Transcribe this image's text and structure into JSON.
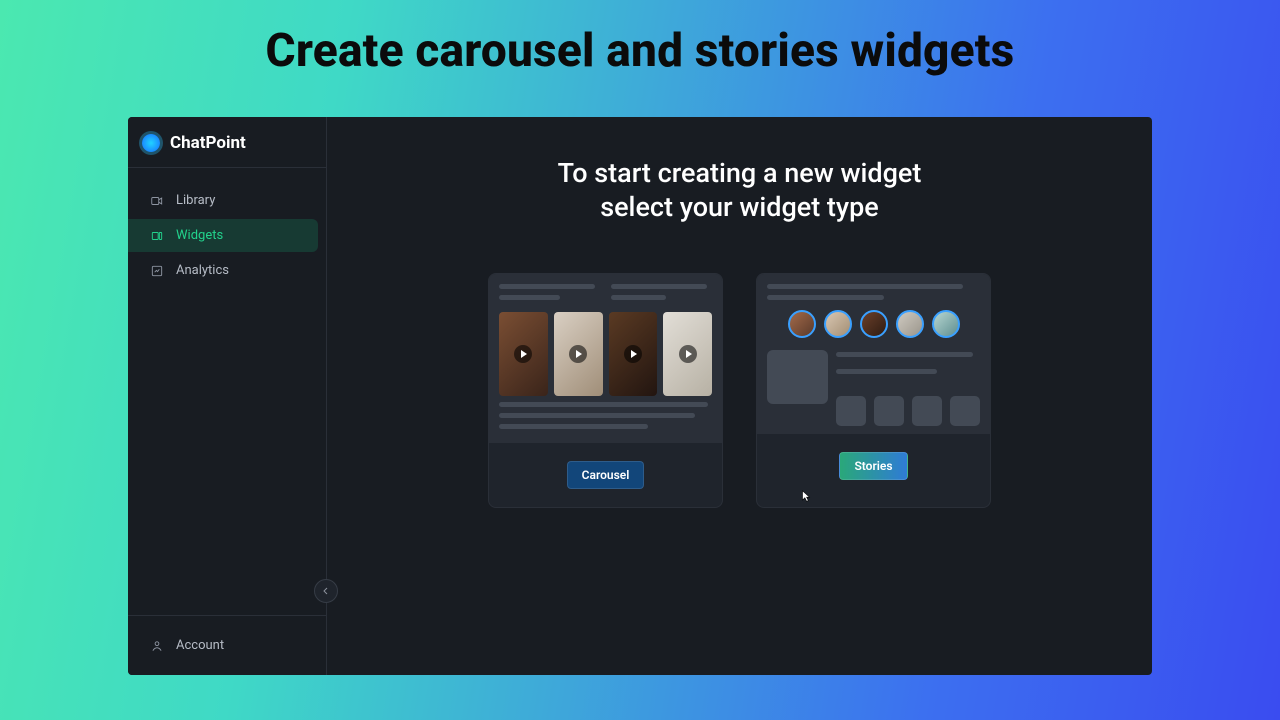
{
  "page": {
    "headline": "Create carousel and stories widgets"
  },
  "brand": {
    "name": "ChatPoint"
  },
  "sidebar": {
    "items": [
      {
        "label": "Library"
      },
      {
        "label": "Widgets"
      },
      {
        "label": "Analytics"
      }
    ],
    "account_label": "Account"
  },
  "main": {
    "title_line1": "To start creating a new widget",
    "title_line2": "select your widget type",
    "cards": {
      "carousel_label": "Carousel",
      "stories_label": "Stories"
    }
  }
}
